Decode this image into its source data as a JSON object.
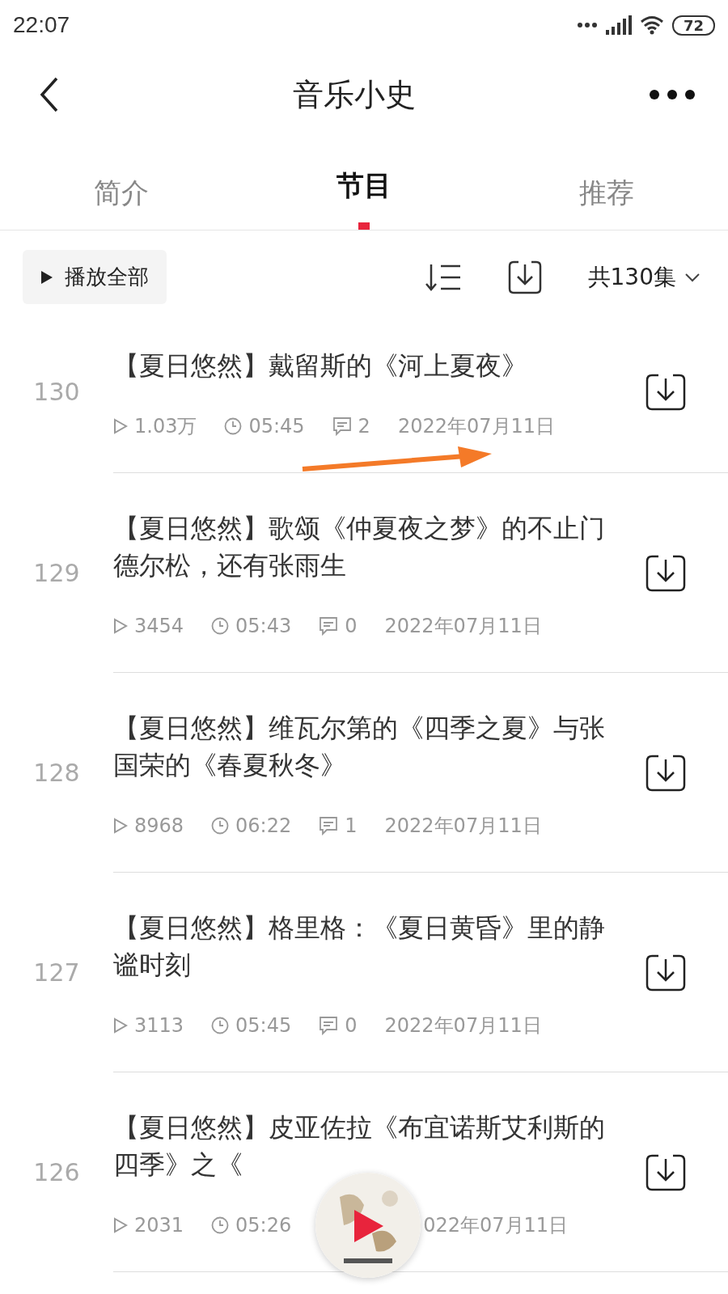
{
  "status_bar": {
    "time": "22:07",
    "battery": "72"
  },
  "nav": {
    "title": "音乐小史"
  },
  "tabs": [
    {
      "label": "简介",
      "selected": false
    },
    {
      "label": "节目",
      "selected": true
    },
    {
      "label": "推荐",
      "selected": false
    }
  ],
  "toolbar": {
    "play_all": "播放全部",
    "episode_count": "共130集"
  },
  "episodes": [
    {
      "number": "130",
      "title": "【夏日悠然】戴留斯的《河上夏夜》",
      "plays": "1.03万",
      "duration": "05:45",
      "comments": "2",
      "date": "2022年07月11日"
    },
    {
      "number": "129",
      "title": "【夏日悠然】歌颂《仲夏夜之梦》的不止门德尔松，还有张雨生",
      "plays": "3454",
      "duration": "05:43",
      "comments": "0",
      "date": "2022年07月11日"
    },
    {
      "number": "128",
      "title": "【夏日悠然】维瓦尔第的《四季之夏》与张国荣的《春夏秋冬》",
      "plays": "8968",
      "duration": "06:22",
      "comments": "1",
      "date": "2022年07月11日"
    },
    {
      "number": "127",
      "title": "【夏日悠然】格里格：《夏日黄昏》里的静谧时刻",
      "plays": "3113",
      "duration": "05:45",
      "comments": "0",
      "date": "2022年07月11日"
    },
    {
      "number": "126",
      "title": "【夏日悠然】皮亚佐拉《布宜诺斯艾利斯的四季》之《",
      "plays": "2031",
      "duration": "05:26",
      "date": "022年07月11日"
    }
  ]
}
